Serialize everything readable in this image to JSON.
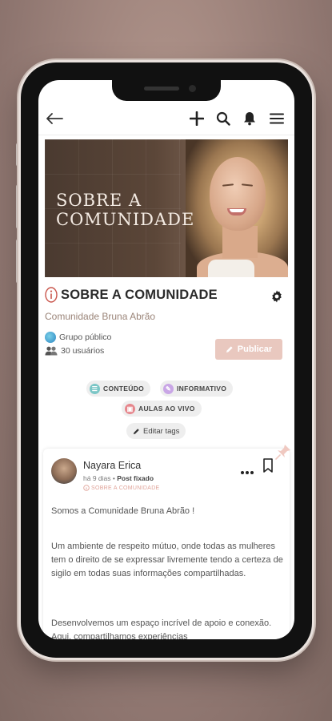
{
  "header": {
    "back_icon": "arrow-left-icon",
    "add_icon": "plus-icon",
    "search_icon": "search-icon",
    "bell_icon": "bell-icon",
    "menu_icon": "hamburger-menu-icon"
  },
  "banner": {
    "title_line1": "SOBRE A",
    "title_line2": "COMUNIDADE"
  },
  "group": {
    "title": "SOBRE A COMUNIDADE",
    "community": "Comunidade Bruna Abrão",
    "visibility": "Grupo público",
    "members": "30 usuários",
    "publish_label": "Publicar",
    "settings_icon": "gear-icon",
    "info_icon": "info-icon"
  },
  "tags": [
    {
      "label": "CONTEÚDO",
      "color": "#7bc6c6"
    },
    {
      "label": "INFORMATIVO",
      "color": "#c9a6e6"
    },
    {
      "label": "AULAS AO VIVO",
      "color": "#e6868c"
    }
  ],
  "edit_tags_label": "Editar tags",
  "post": {
    "author": "Nayara Erica",
    "time": "há 9 dias",
    "separator": "•",
    "pinned": "Post fixado",
    "category": "SOBRE A COMUNIDADE",
    "paragraph1": "Somos a Comunidade Bruna Abrão !",
    "paragraph2": "Um ambiente de respeito mútuo, onde todas as mulheres tem o direito de se expressar livremente tendo a certeza de sigilo em todas suas informações compartilhadas.",
    "paragraph3": "Desenvolvemos um espaço incrível de apoio e conexão. Aqui, compartilhamos experiências"
  },
  "colors": {
    "accent": "#e9c8bf",
    "category": "#e0a49a"
  }
}
